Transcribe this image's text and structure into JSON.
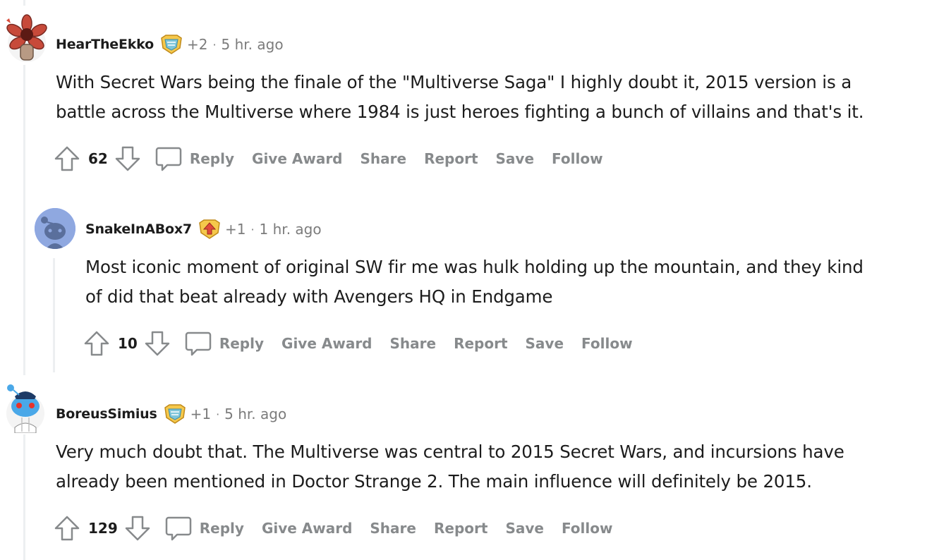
{
  "comments": [
    {
      "username": "HearTheEkko",
      "karma": "+2",
      "time": "5 hr. ago",
      "body_line1": "With Secret Wars being the finale of the \"Multiverse Saga\" I highly doubt it, 2015 version is a",
      "body_line2": "battle across the Multiverse where 1984 is just heroes fighting a bunch of villains and that's it.",
      "score": "62"
    },
    {
      "username": "SnakeInABox7",
      "karma": "+1",
      "time": "1 hr. ago",
      "body_line1": "Most iconic moment of original SW fir me was hulk holding up the mountain, and they kind",
      "body_line2": "of did that beat already with Avengers HQ in Endgame",
      "score": "10"
    },
    {
      "username": "BoreusSimius",
      "karma": "+1",
      "time": "5 hr. ago",
      "body_line1": "Very much doubt that. The Multiverse was central to 2015 Secret Wars, and incursions have",
      "body_line2": "already been mentioned in Doctor Strange 2. The main influence will definitely be 2015.",
      "score": "129"
    }
  ],
  "actions": {
    "reply": "Reply",
    "give_award": "Give Award",
    "share": "Share",
    "report": "Report",
    "save": "Save",
    "follow": "Follow"
  },
  "separator": "·",
  "colors": {
    "thread_line": "#edeff1",
    "muted_text": "#7c7c7c",
    "action_text": "#878a8c",
    "snoo_blue": "#6a8ec9"
  },
  "icons": [
    "upvote-icon",
    "downvote-icon",
    "comment-icon",
    "flair-icon",
    "avatar"
  ]
}
